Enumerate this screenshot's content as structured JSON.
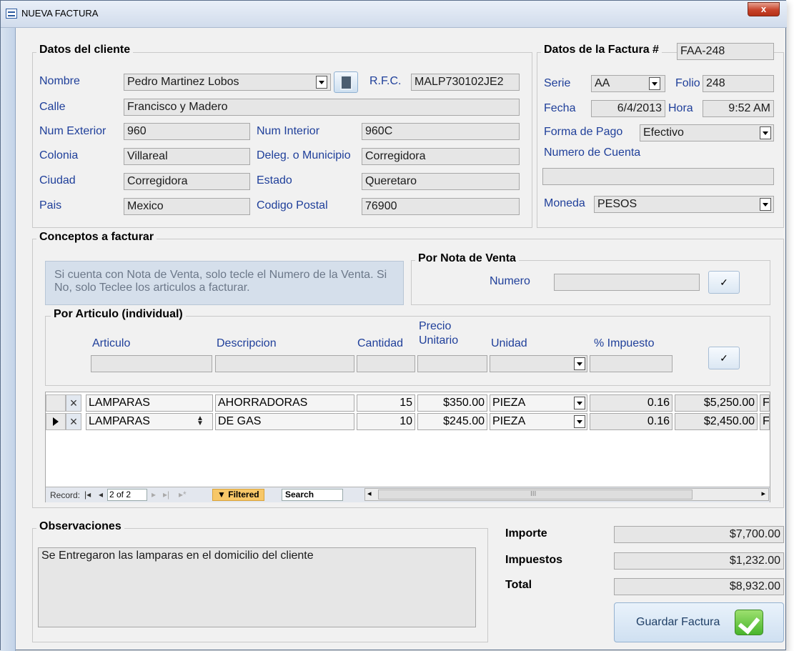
{
  "window": {
    "title": "NUEVA FACTURA",
    "close_label": "x"
  },
  "cliente": {
    "group_title": "Datos del cliente",
    "labels": {
      "nombre": "Nombre",
      "rfc": "R.F.C.",
      "calle": "Calle",
      "num_exterior": "Num Exterior",
      "num_interior": "Num Interior",
      "colonia": "Colonia",
      "deleg": "Deleg. o Municipio",
      "ciudad": "Ciudad",
      "estado": "Estado",
      "pais": "Pais",
      "codigo_postal": "Codigo Postal"
    },
    "values": {
      "nombre": "Pedro Martinez Lobos",
      "rfc": "MALP730102JE2",
      "calle": "Francisco y Madero",
      "num_exterior": "960",
      "num_interior": "960C",
      "colonia": "Villareal",
      "deleg": "Corregidora",
      "ciudad": "Corregidora",
      "estado": "Queretaro",
      "pais": "Mexico",
      "codigo_postal": "76900"
    }
  },
  "factura": {
    "group_title": "Datos de la Factura #",
    "numero": "FAA-248",
    "labels": {
      "serie": "Serie",
      "folio": "Folio",
      "fecha": "Fecha",
      "hora": "Hora",
      "forma_pago": "Forma de Pago",
      "numero_cuenta": "Numero de Cuenta",
      "moneda": "Moneda"
    },
    "values": {
      "serie": "AA",
      "folio": "248",
      "fecha": "6/4/2013",
      "hora": "9:52 AM",
      "forma_pago": "Efectivo",
      "numero_cuenta": "",
      "moneda": "PESOS"
    }
  },
  "conceptos": {
    "group_title": "Conceptos a facturar",
    "info_text": "Si cuenta con Nota de Venta, solo tecle el Numero de la Venta. Si No, solo Teclee los articulos a facturar.",
    "nota_venta": {
      "title": "Por Nota de Venta",
      "numero_label": "Numero",
      "numero_value": ""
    },
    "check_glyph": "✓",
    "articulo": {
      "title": "Por Articulo (individual)",
      "headers": {
        "articulo": "Articulo",
        "descripcion": "Descripcion",
        "cantidad": "Cantidad",
        "precio_line1": "Precio",
        "precio_line2": "Unitario",
        "unidad": "Unidad",
        "impuesto": "% Impuesto"
      }
    },
    "rows": [
      {
        "articulo": "LAMPARAS",
        "descripcion": "AHORRADORAS",
        "cantidad": "15",
        "precio": "$350.00",
        "unidad": "PIEZA",
        "impuesto": "0.16",
        "importe": "$5,250.00",
        "extra": "F"
      },
      {
        "articulo": "LAMPARAS",
        "descripcion": "DE GAS",
        "cantidad": "10",
        "precio": "$245.00",
        "unidad": "PIEZA",
        "impuesto": "0.16",
        "importe": "$2,450.00",
        "extra": "F"
      }
    ],
    "navbar": {
      "record_label": "Record:",
      "record_value": "2 of 2",
      "filtered_label": "Filtered",
      "search_label": "Search",
      "scroll_mark": "III"
    }
  },
  "observaciones": {
    "title": "Observaciones",
    "text": "Se Entregaron las lamparas en el domicilio del cliente"
  },
  "totales": {
    "importe_label": "Importe",
    "importe": "$7,700.00",
    "impuestos_label": "Impuestos",
    "impuestos": "$1,232.00",
    "total_label": "Total",
    "total": "$8,932.00",
    "guardar_label": "Guardar Factura"
  }
}
